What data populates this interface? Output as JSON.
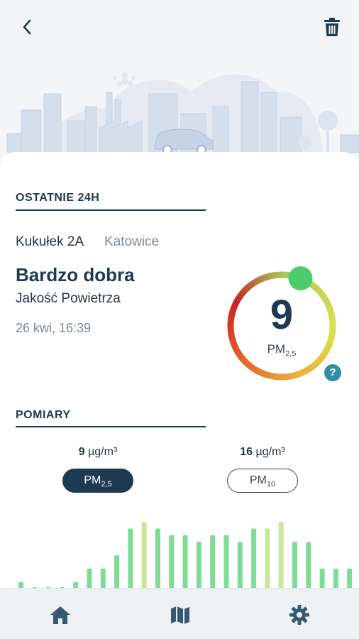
{
  "header": {
    "back_icon": "chevron-left-icon",
    "delete_icon": "trash-icon"
  },
  "last24h": {
    "title": "OSTATNIE 24H",
    "street": "Kukułek 2A",
    "city": "Katowice",
    "quality": "Bardzo dobra",
    "quality_sub": "Jakość Powietrza",
    "timestamp": "26 kwi, 16:39",
    "gauge": {
      "value": "9",
      "label": "PM",
      "label_sub": "2,5",
      "help": "?",
      "level_fraction": 0.06
    }
  },
  "measurements": {
    "title": "POMIARY",
    "pm25": {
      "value": "9",
      "unit": "µg/m³",
      "label": "PM",
      "label_sub": "2,5",
      "selected": true
    },
    "pm10": {
      "value": "16",
      "unit": "µg/m³",
      "label": "PM",
      "label_sub": "10",
      "selected": false
    }
  },
  "chart_data": {
    "type": "bar",
    "values": [
      1,
      0,
      0,
      0,
      1,
      3,
      3,
      5,
      9,
      10,
      9,
      8,
      8,
      7,
      8,
      8,
      7,
      9,
      9,
      10,
      7,
      7,
      3,
      3,
      3,
      2
    ],
    "highlight_indices": [
      9,
      18,
      19
    ],
    "ylim": [
      0,
      10
    ],
    "colors": {
      "normal": "#7fdc96",
      "highlight": "#c9e79a"
    }
  },
  "nav": {
    "items": [
      {
        "icon": "home-icon"
      },
      {
        "icon": "map-icon"
      },
      {
        "icon": "gear-icon"
      }
    ]
  },
  "colors": {
    "primary": "#1e3a52",
    "help": "#2f8fa3",
    "gauge_dot": "#4ccd6c"
  }
}
